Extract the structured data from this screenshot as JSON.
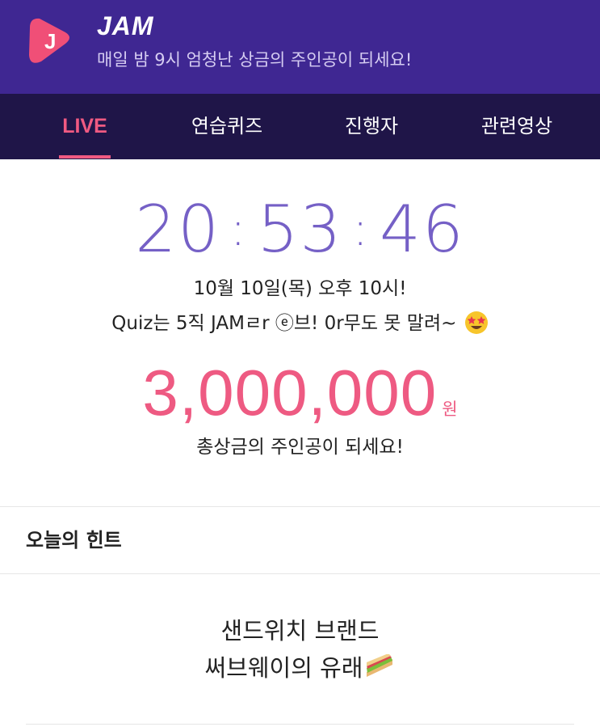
{
  "header": {
    "app_name": "JAM",
    "logo_letter": "J",
    "tagline": "매일 밤 9시 엄청난 상금의 주인공이 되세요!",
    "colors": {
      "bar": "#3f2792",
      "logo": "#f04f77"
    }
  },
  "tabs": [
    {
      "label": "LIVE",
      "active": true
    },
    {
      "label": "연습퀴즈",
      "active": false
    },
    {
      "label": "진행자",
      "active": false
    },
    {
      "label": "관련영상",
      "active": false
    }
  ],
  "countdown": {
    "hours": "20",
    "minutes": "53",
    "seconds": "46",
    "color": "#7560c6"
  },
  "event": {
    "date_line": "10월 10일(목) 오후 10시!",
    "quiz_line": "Quiz는 5직 JAMㄹr ⓔ브! 0r무도 못 말려~",
    "quiz_emoji": "star-struck-emoji"
  },
  "prize": {
    "amount": "3,000,000",
    "unit": "원",
    "caption": "총상금의 주인공이 되세요!",
    "color": "#ee5a82"
  },
  "hint": {
    "title": "오늘의 힌트",
    "line1": "샌드위치 브랜드",
    "line2": "써브웨이의 유래",
    "emoji": "sandwich-emoji"
  }
}
